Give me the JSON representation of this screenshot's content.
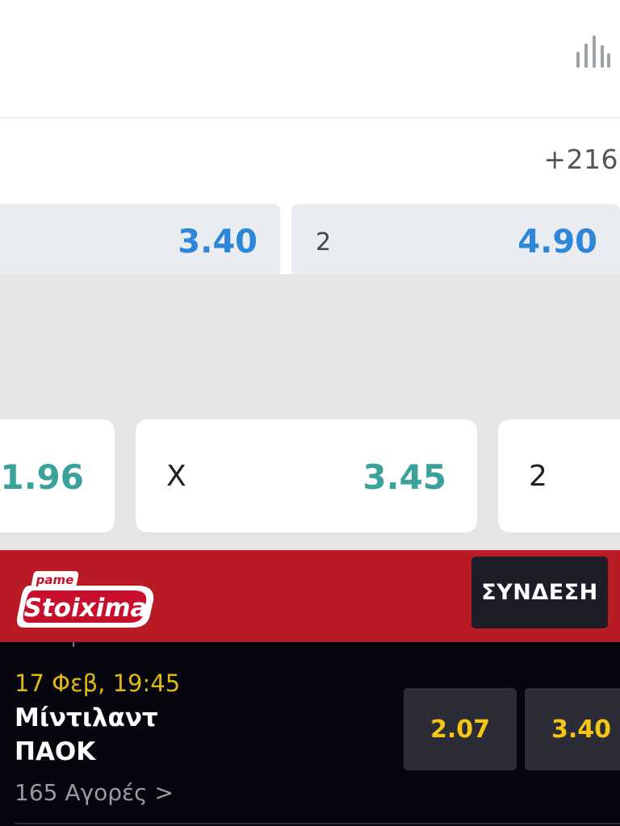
{
  "section1": {
    "more_markets": "+216",
    "odds": [
      {
        "label": "",
        "value": "3.40"
      },
      {
        "label": "2",
        "value": "4.90"
      }
    ]
  },
  "section2": {
    "odds": [
      {
        "label": "",
        "value": "1.96"
      },
      {
        "label": "X",
        "value": "3.45"
      },
      {
        "label": "2",
        "value": ""
      }
    ]
  },
  "brand": {
    "logo_top": "pame",
    "logo_main": "Stoixima",
    "login_label": "ΣΥΝΔΕΣΗ"
  },
  "match": {
    "datetime": "17 Φεβ, 19:45",
    "home": "Μίντιλαντ",
    "away": "ΠΑΟΚ",
    "markets": "165 Αγορές >",
    "odds": [
      "2.07",
      "3.40"
    ]
  },
  "colors": {
    "brand_red": "#b81b23",
    "odds_blue": "#2e86d8",
    "odds_teal": "#3aa19b",
    "odds_yellow": "#f5c518",
    "date_yellow": "#e0b80f"
  },
  "icons": {
    "stats": "bar-chart-icon"
  }
}
